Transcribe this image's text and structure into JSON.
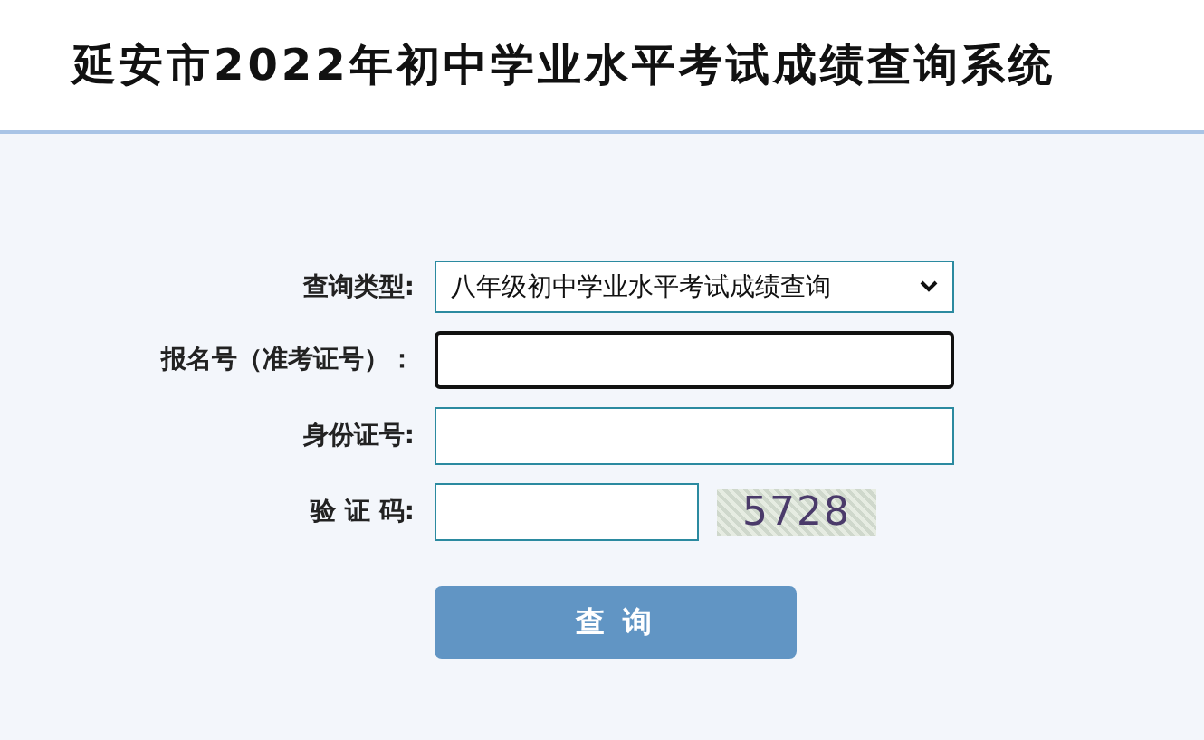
{
  "header": {
    "title": "延安市2022年初中学业水平考试成绩查询系统"
  },
  "form": {
    "fields": [
      {
        "kind": "select",
        "label": "查询类型:",
        "value": "八年级初中学业水平考试成绩查询",
        "focused": false
      },
      {
        "kind": "input",
        "label": "报名号（准考证号）：",
        "focused": true
      },
      {
        "kind": "input",
        "label": "身份证号:",
        "focused": false
      },
      {
        "kind": "captcha",
        "label": "验 证 码:",
        "focused": false,
        "captcha": "5728"
      }
    ],
    "submit": "查 询"
  }
}
